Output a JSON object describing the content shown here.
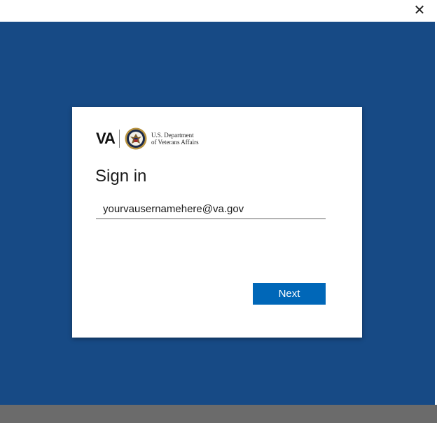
{
  "window": {
    "close_glyph": "✕"
  },
  "logo": {
    "va_mark": "VA",
    "line1": "U.S. Department",
    "line2": "of Veterans Affairs",
    "seal_icon": "va-seal-icon"
  },
  "signin": {
    "title": "Sign in",
    "email_value": "yourvausernamehere@va.gov",
    "next_label": "Next"
  },
  "colors": {
    "background": "#174a85",
    "button": "#0067b8",
    "taskbar": "#6b6b6b"
  }
}
